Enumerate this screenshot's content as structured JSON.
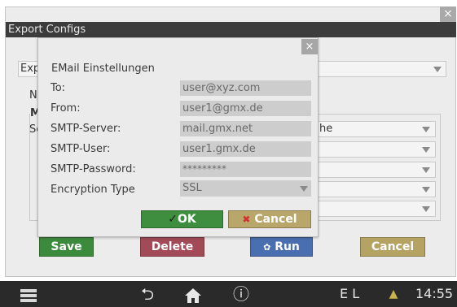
{
  "outer_dialog": {
    "title": "Export Configs",
    "close_icon": "×",
    "covered": {
      "select_1_value": "Exp",
      "label_na": "Na",
      "label_m": "M",
      "label_s": "Se",
      "server_select_value": "he"
    },
    "buttons": {
      "save": "Save",
      "delete": "Delete",
      "run": "Run",
      "cancel": "Cancel"
    }
  },
  "email_dialog": {
    "title": "EMail Einstellungen",
    "close_icon": "×",
    "fields": [
      {
        "label": "To:",
        "value": "user@xyz.com"
      },
      {
        "label": "From:",
        "value": "user1@gmx.de"
      },
      {
        "label": "SMTP-Server:",
        "value": "mail.gmx.net"
      },
      {
        "label": "SMTP-User:",
        "value": "user1.gmx.de"
      },
      {
        "label": "SMTP-Password:",
        "value": "*********"
      }
    ],
    "encryption": {
      "label": "Encryption Type",
      "value": "SSL"
    },
    "ok_label": "OK",
    "cancel_label": "Cancel"
  },
  "taskbar": {
    "keyboard_indicator": "E L",
    "clock": "14:55"
  },
  "colors": {
    "save": "#3c8a3c",
    "delete": "#a34a58",
    "run": "#4a6fb0",
    "cancel": "#b5a364",
    "taskbar": "#2a2a2a"
  }
}
